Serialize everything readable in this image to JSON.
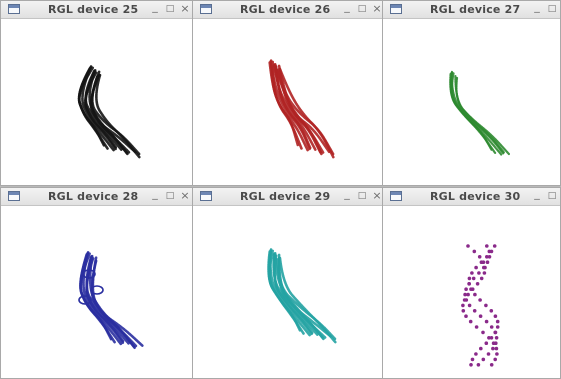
{
  "windows": [
    {
      "title": "RGL device 25",
      "color": "#151515",
      "plot": "dense"
    },
    {
      "title": "RGL device 26",
      "color": "#b02323",
      "plot": "dense"
    },
    {
      "title": "RGL device 27",
      "color": "#2e8a30",
      "plot": "thin"
    },
    {
      "title": "RGL device 28",
      "color": "#2a2fa0",
      "plot": "loops"
    },
    {
      "title": "RGL device 29",
      "color": "#25a3a3",
      "plot": "dense"
    },
    {
      "title": "RGL device 30",
      "color": "#8a2a8a",
      "plot": "dots"
    }
  ],
  "controls": {
    "minimize": "_",
    "maximize": "□",
    "close": "×"
  }
}
